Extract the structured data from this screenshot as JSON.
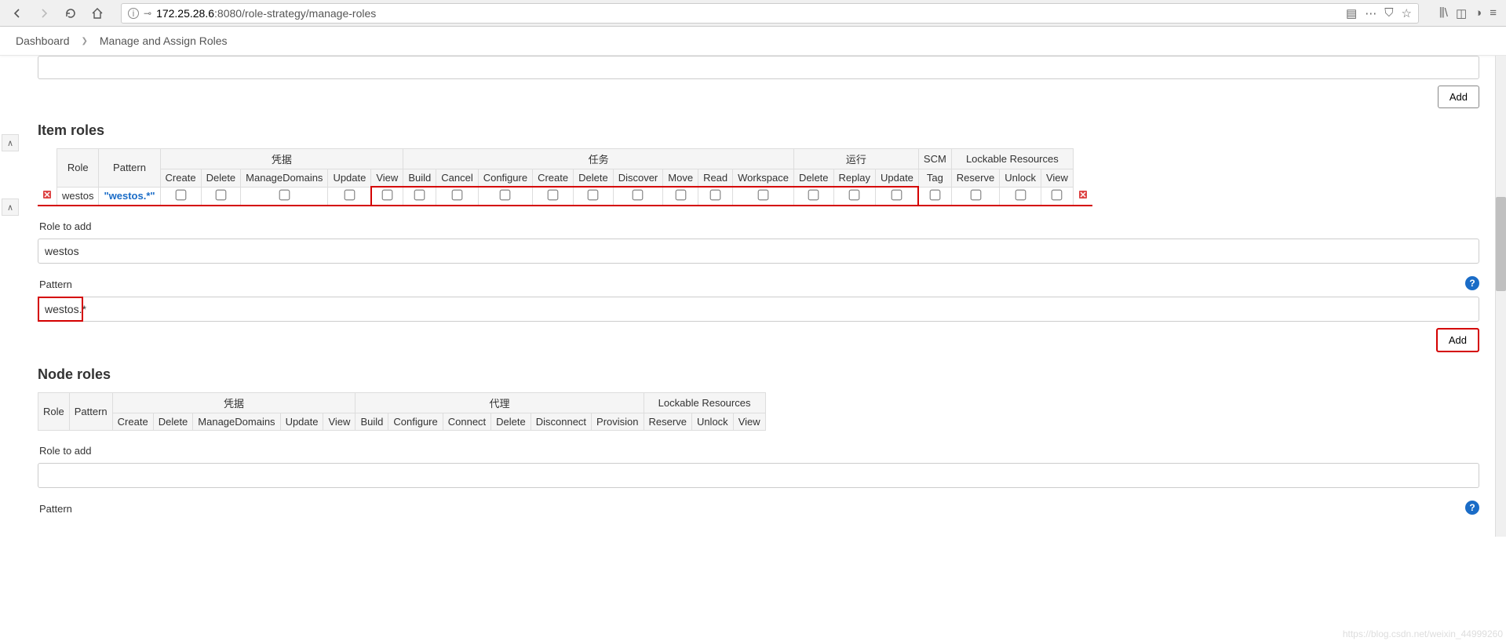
{
  "browser": {
    "url_prefix": "ⓘ ⊸",
    "url_host": "172.25.28.6",
    "url_rest": ":8080/role-strategy/manage-roles"
  },
  "breadcrumb": {
    "item1": "Dashboard",
    "item2": "Manage and Assign Roles"
  },
  "sections": {
    "item_roles_title": "Item roles",
    "node_roles_title": "Node roles"
  },
  "item_table": {
    "role_header": "Role",
    "pattern_header": "Pattern",
    "group_credentials": "凭据",
    "group_tasks": "任务",
    "group_run": "运行",
    "group_scm": "SCM",
    "group_lockable": "Lockable Resources",
    "cols": {
      "c_create": "Create",
      "c_delete": "Delete",
      "c_md": "ManageDomains",
      "c_update": "Update",
      "c_view": "View",
      "t_build": "Build",
      "t_cancel": "Cancel",
      "t_configure": "Configure",
      "t_create": "Create",
      "t_delete": "Delete",
      "t_discover": "Discover",
      "t_move": "Move",
      "t_read": "Read",
      "t_workspace": "Workspace",
      "r_delete": "Delete",
      "r_replay": "Replay",
      "r_update": "Update",
      "s_tag": "Tag",
      "l_reserve": "Reserve",
      "l_unlock": "Unlock",
      "l_view": "View"
    },
    "row": {
      "role": "westos",
      "pattern": "\"westos.*\"",
      "checks": {
        "c_create": false,
        "c_delete": false,
        "c_md": false,
        "c_update": false,
        "c_view": true,
        "t_build": true,
        "t_cancel": true,
        "t_configure": true,
        "t_create": true,
        "t_delete": true,
        "t_discover": true,
        "t_move": true,
        "t_read": true,
        "t_workspace": true,
        "r_delete": true,
        "r_replay": true,
        "r_update": true,
        "s_tag": false,
        "l_reserve": false,
        "l_unlock": false,
        "l_view": false
      }
    }
  },
  "node_table": {
    "role_header": "Role",
    "pattern_header": "Pattern",
    "group_credentials": "凭据",
    "group_agent": "代理",
    "group_lockable": "Lockable Resources",
    "cols": {
      "c_create": "Create",
      "c_delete": "Delete",
      "c_md": "ManageDomains",
      "c_update": "Update",
      "c_view": "View",
      "a_build": "Build",
      "a_configure": "Configure",
      "a_connect": "Connect",
      "a_delete": "Delete",
      "a_disconnect": "Disconnect",
      "a_provision": "Provision",
      "l_reserve": "Reserve",
      "l_unlock": "Unlock",
      "l_view": "View"
    }
  },
  "form": {
    "role_label": "Role to add",
    "role_value": "westos",
    "pattern_label": "Pattern",
    "pattern_value": "westos.*",
    "node_role_value": "",
    "add_label": "Add"
  },
  "watermark": "https://blog.csdn.net/weixin_44999260"
}
